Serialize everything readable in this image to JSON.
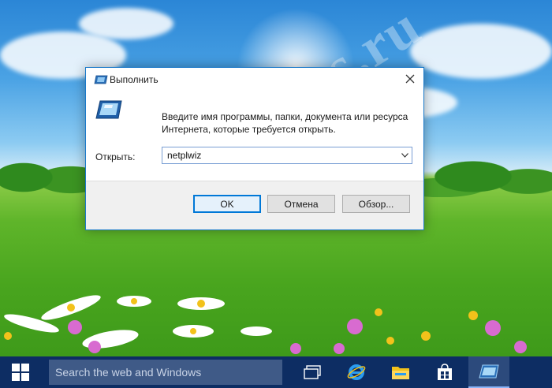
{
  "dialog": {
    "title": "Выполнить",
    "description": "Введите имя программы, папки, документа или ресурса Интернета, которые требуется открыть.",
    "open_label": "Открыть:",
    "open_value": "netplwiz",
    "ok_label": "OK",
    "cancel_label": "Отмена",
    "browse_label": "Обзор..."
  },
  "watermark": "All4os.ru",
  "taskbar": {
    "search_placeholder": "Search the web and Windows",
    "icons": [
      "windows-start-icon",
      "task-view-icon",
      "internet-explorer-icon",
      "file-explorer-icon",
      "store-icon",
      "run-icon"
    ]
  },
  "colors": {
    "taskbar": "#0d2d63",
    "search_box": "#3f5a87",
    "accent": "#0078d7",
    "dialog_border": "#1979ca"
  }
}
